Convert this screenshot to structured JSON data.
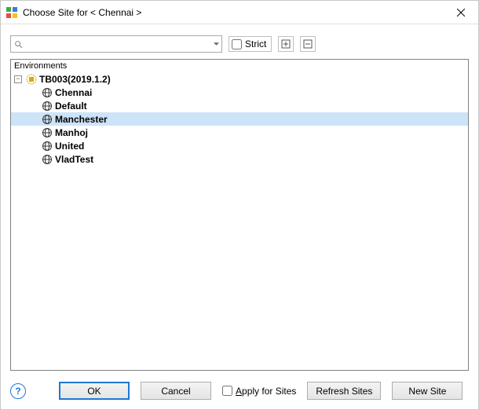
{
  "window": {
    "title": "Choose Site for < Chennai >"
  },
  "toolbar": {
    "search_value": "",
    "search_placeholder": "",
    "strict_label": "Strict",
    "strict_checked": false
  },
  "tree": {
    "header": "Environments",
    "root": {
      "label": "TB003(2019.1.2)",
      "expanded": true
    },
    "items": [
      {
        "label": "Chennai",
        "selected": false
      },
      {
        "label": "Default",
        "selected": false
      },
      {
        "label": "Manchester",
        "selected": true
      },
      {
        "label": "Manhoj",
        "selected": false
      },
      {
        "label": "United",
        "selected": false
      },
      {
        "label": "VladTest",
        "selected": false
      }
    ]
  },
  "buttons": {
    "ok": "OK",
    "cancel": "Cancel",
    "apply_for_sites": "Apply for Sites",
    "apply_checked": false,
    "refresh": "Refresh Sites",
    "new_site": "New Site"
  }
}
